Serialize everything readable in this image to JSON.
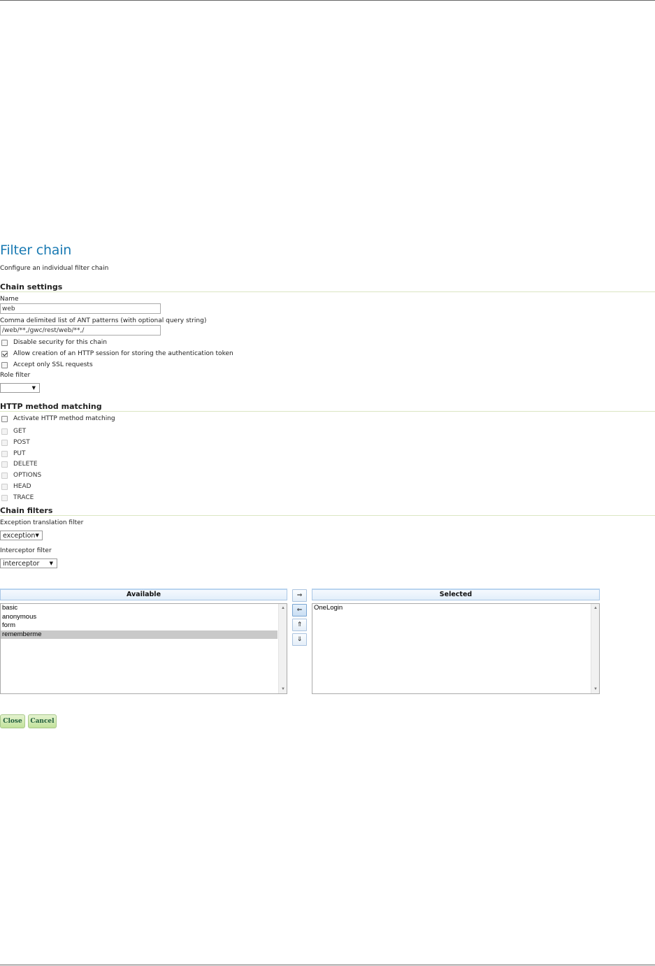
{
  "page": {
    "title": "Filter chain",
    "description": "Configure an individual filter chain"
  },
  "chain_settings": {
    "heading": "Chain settings",
    "name_label": "Name",
    "name_value": "web",
    "patterns_label": "Comma delimited list of ANT patterns (with optional query string)",
    "patterns_value": "/web/**,/gwc/rest/web/**,/",
    "checkboxes": [
      {
        "label": "Disable security for this chain",
        "checked": false
      },
      {
        "label": "Allow creation of an HTTP session for storing the authentication token",
        "checked": true
      },
      {
        "label": "Accept only SSL requests",
        "checked": false
      }
    ],
    "role_filter_label": "Role filter",
    "role_filter_value": ""
  },
  "http_methods": {
    "heading": "HTTP method matching",
    "activate_label": "Activate HTTP method matching",
    "activate_checked": false,
    "methods": [
      "GET",
      "POST",
      "PUT",
      "DELETE",
      "OPTIONS",
      "HEAD",
      "TRACE"
    ]
  },
  "chain_filters": {
    "heading": "Chain filters",
    "exception_label": "Exception translation filter",
    "exception_value": "exception",
    "interceptor_label": "Interceptor filter",
    "interceptor_value": "interceptor",
    "available_header": "Available",
    "selected_header": "Selected",
    "available": [
      "basic",
      "anonymous",
      "form",
      "rememberme"
    ],
    "available_selected_index": 3,
    "selected": [
      "OneLogin"
    ],
    "buttons": {
      "add": "⇒",
      "remove": "⇐",
      "up": "⇑",
      "down": "⇓"
    }
  },
  "actions": {
    "close": "Close",
    "cancel": "Cancel"
  }
}
